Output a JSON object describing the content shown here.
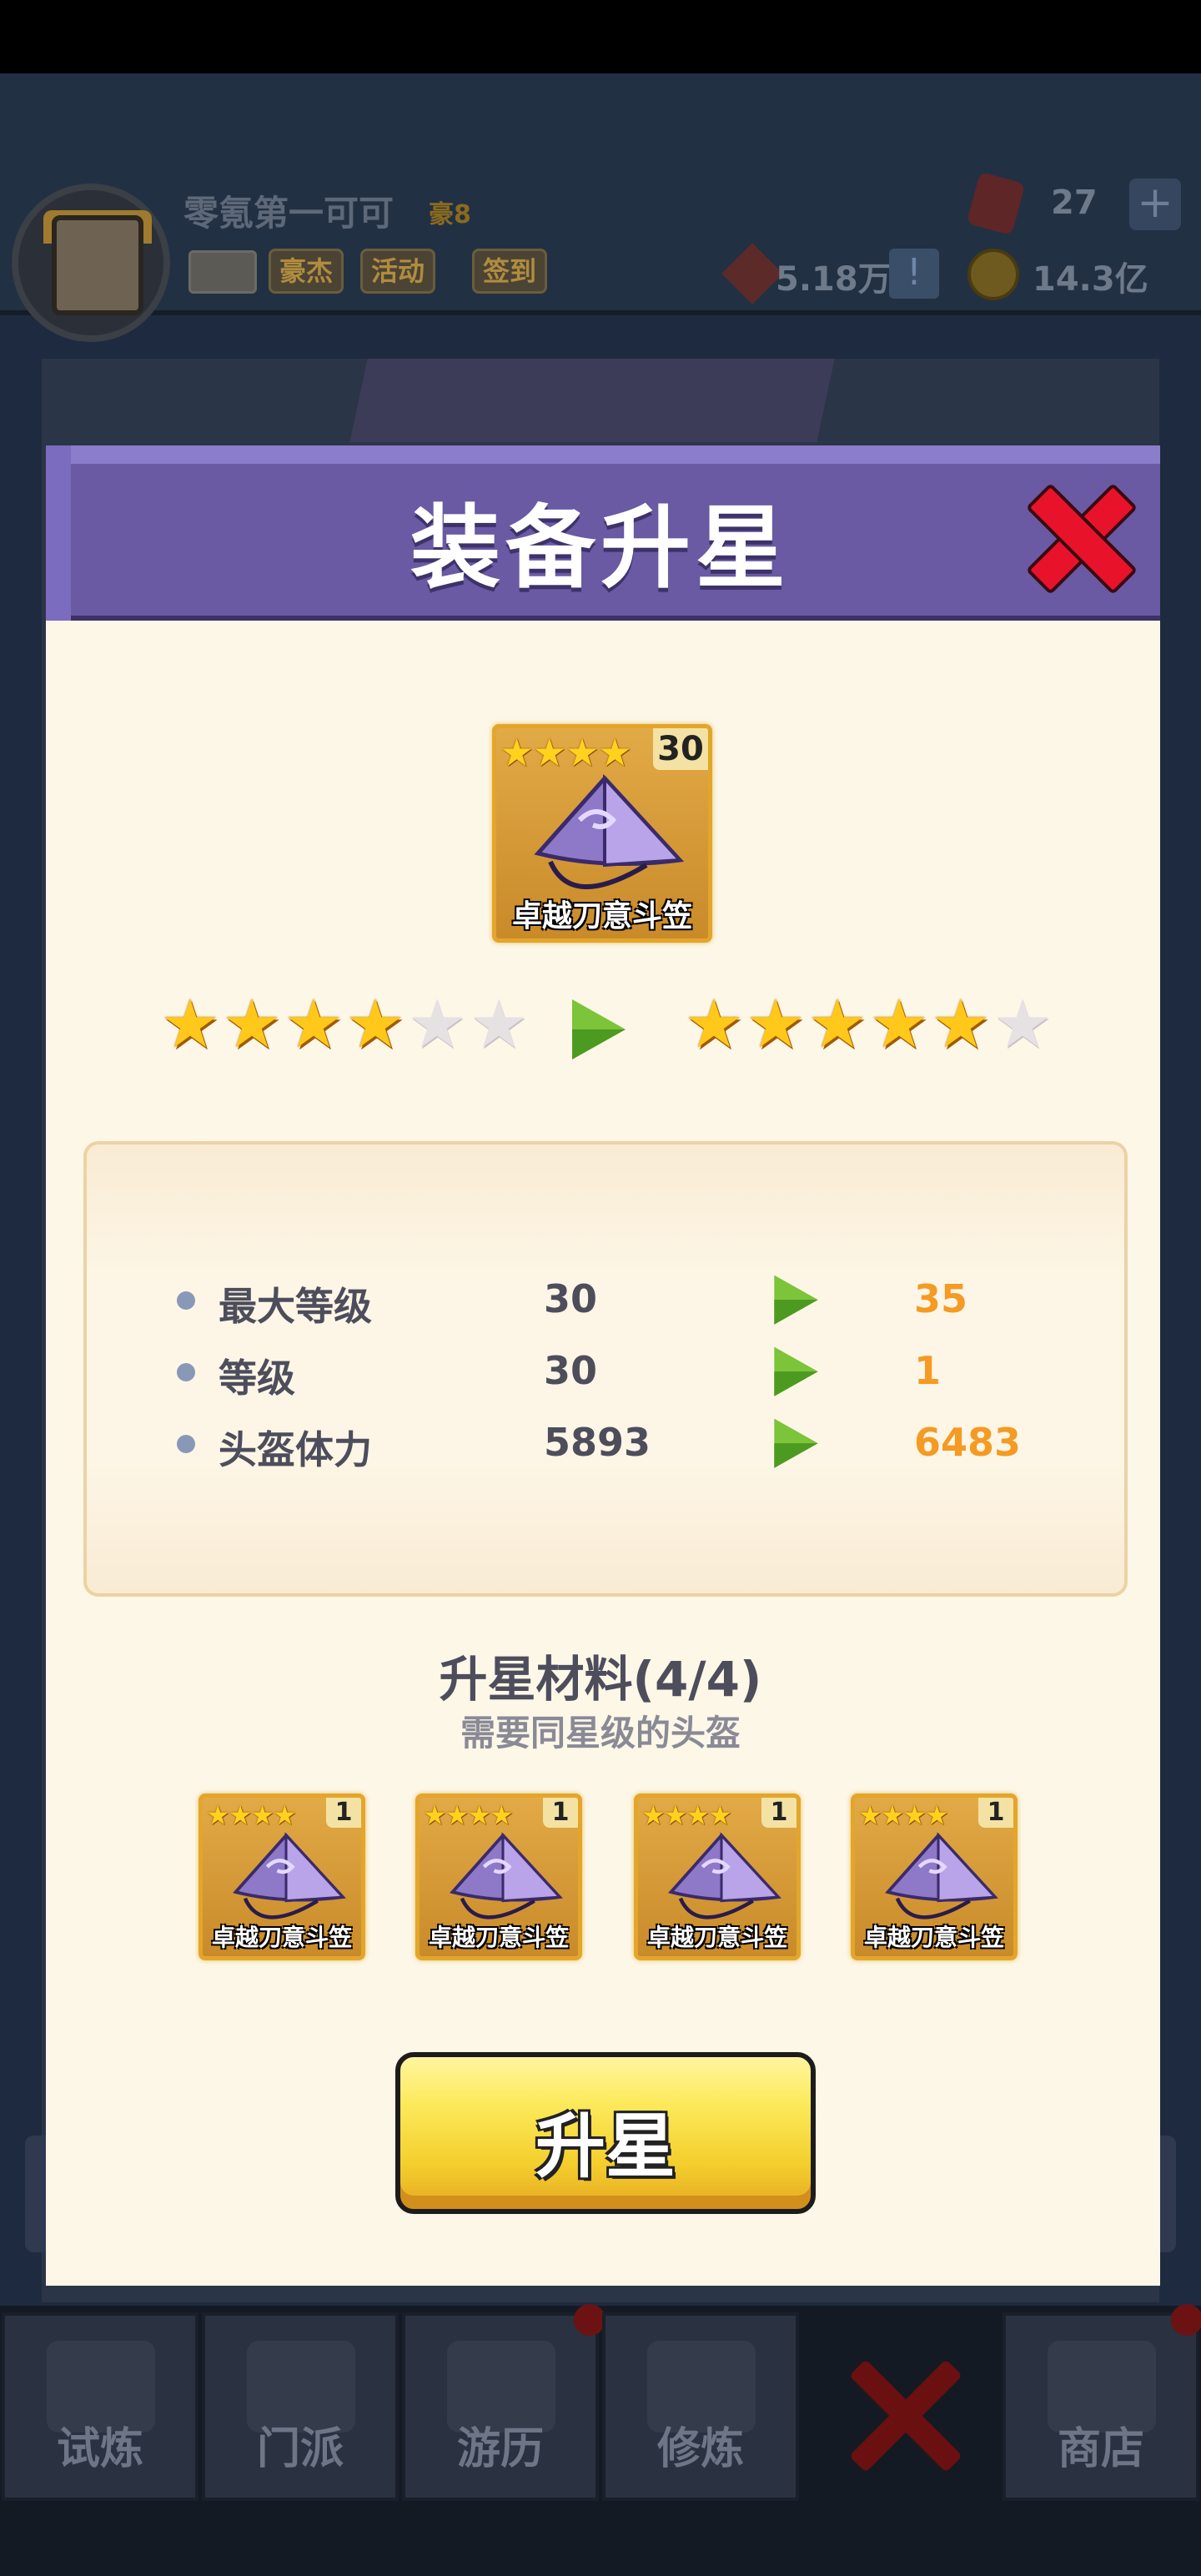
{
  "player": {
    "name": "零氪第一可可",
    "vip": "豪8",
    "gems": "27",
    "power": "5.18万",
    "coins": "14.3亿"
  },
  "hud_buttons": [
    "豪杰",
    "活动",
    "签到"
  ],
  "modal": {
    "title": "装备升星"
  },
  "item": {
    "name": "卓越刀意斗笠",
    "level": "30",
    "stars": 4
  },
  "star_progress": {
    "current": 4,
    "next": 5,
    "max": 6
  },
  "stats": [
    {
      "label": "最大等级",
      "old": "30",
      "new": "35"
    },
    {
      "label": "等级",
      "old": "30",
      "new": "1"
    },
    {
      "label": "头盔体力",
      "old": "5893",
      "new": "6483"
    }
  ],
  "materials": {
    "title": "升星材料(4/4)",
    "subtitle": "需要同星级的头盔",
    "items": [
      {
        "name": "卓越刀意斗笠",
        "level": "1",
        "stars": 4
      },
      {
        "name": "卓越刀意斗笠",
        "level": "1",
        "stars": 4
      },
      {
        "name": "卓越刀意斗笠",
        "level": "1",
        "stars": 4
      },
      {
        "name": "卓越刀意斗笠",
        "level": "1",
        "stars": 4
      }
    ]
  },
  "upgrade_button": "升星",
  "bottom_nav": [
    {
      "label": "试炼"
    },
    {
      "label": "门派"
    },
    {
      "label": "游历"
    },
    {
      "label": "修炼"
    },
    {
      "label": ""
    },
    {
      "label": "商店"
    }
  ],
  "colors": {
    "header_purple": "#6a59a3",
    "modal_cream": "#fdf7e8",
    "stat_new_orange": "#f59a23",
    "button_yellow": "#f4cf2d",
    "close_red": "#e8132b"
  }
}
